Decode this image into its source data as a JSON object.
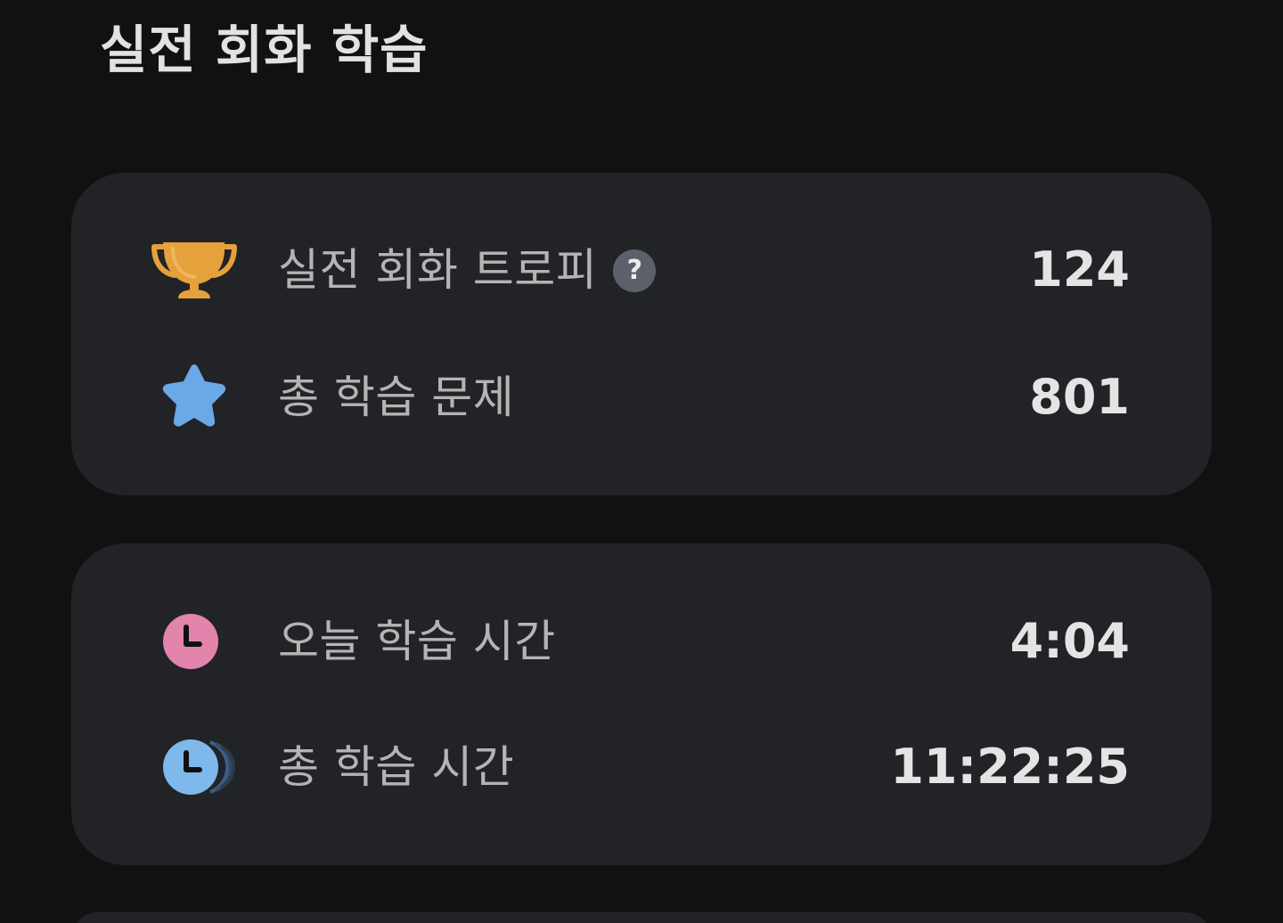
{
  "header": {
    "title": "실전 회화 학습"
  },
  "card1": {
    "trophy": {
      "label": "실전 회화 트로피",
      "help_label": "?",
      "value": "124",
      "icon": "trophy-icon",
      "icon_color": "#e5a13c"
    },
    "problems": {
      "label": "총 학습 문제",
      "value": "801",
      "icon": "star-icon",
      "icon_color": "#6aa8e6"
    }
  },
  "card2": {
    "today_time": {
      "label": "오늘 학습 시간",
      "value": "4:04",
      "icon": "clock-icon",
      "icon_color": "#e384ad"
    },
    "total_time": {
      "label": "총 학습 시간",
      "value": "11:22:25",
      "icon": "clock-stack-icon",
      "icon_color": "#7fb8ea"
    }
  },
  "colors": {
    "background": "#111112",
    "card": "#222327",
    "label": "#b4b4b4",
    "value": "#e4e4e4",
    "help_badge": "#5c6169"
  }
}
